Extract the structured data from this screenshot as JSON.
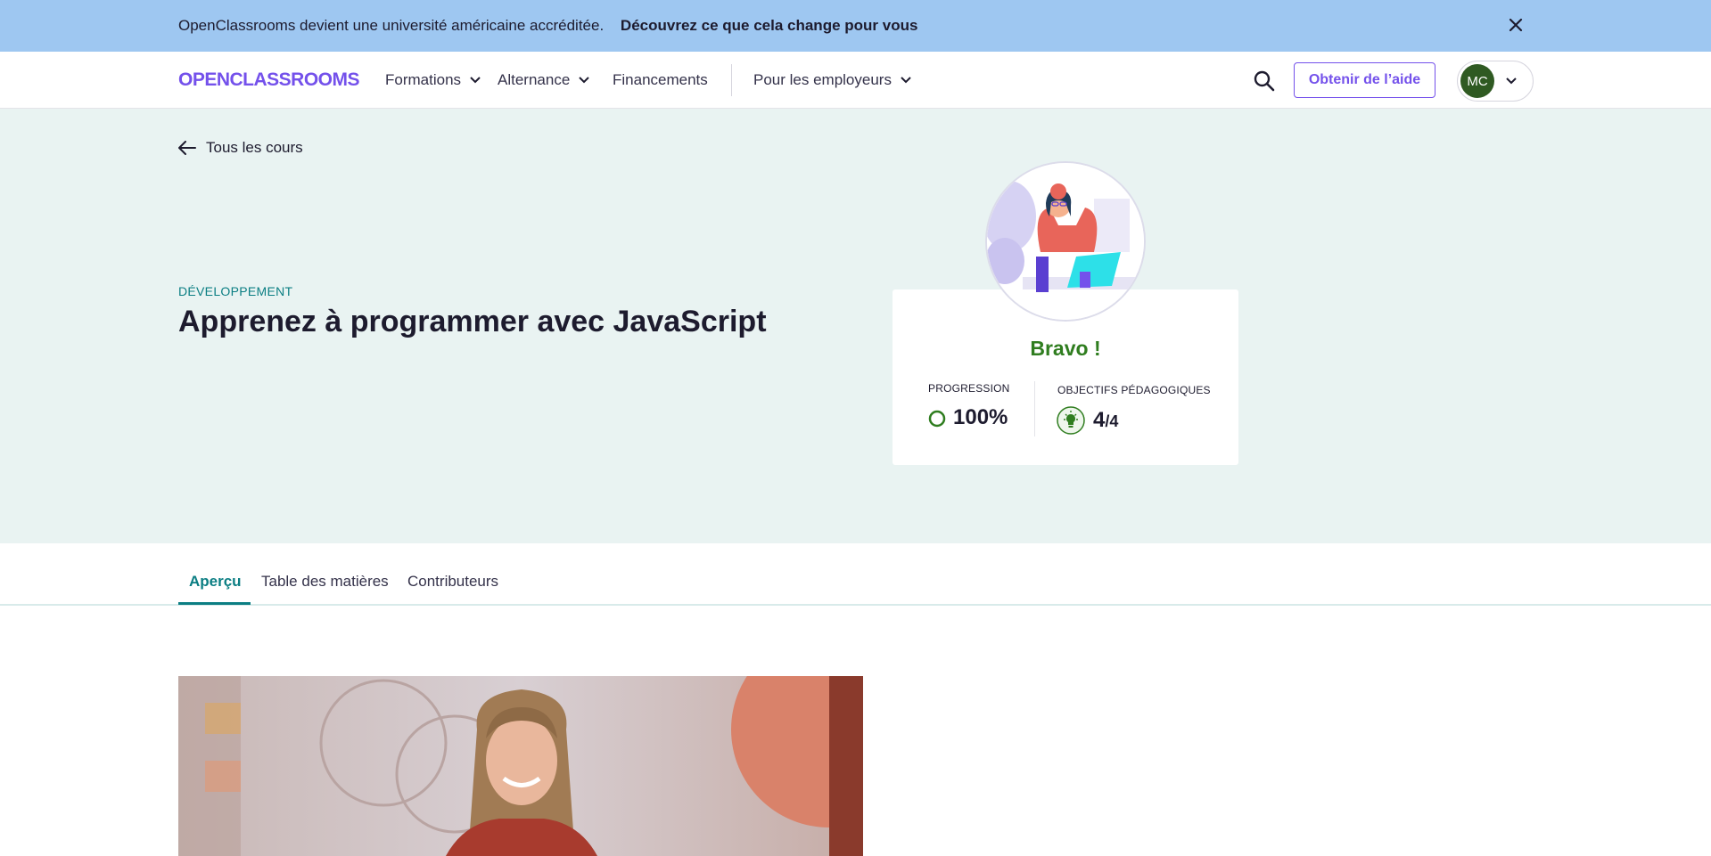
{
  "banner": {
    "text": "OpenClassrooms devient une université américaine accréditée.",
    "link": "Découvrez ce que cela change pour vous"
  },
  "nav": {
    "logo": "OPENCLASSROOMS",
    "items": [
      {
        "label": "Formations"
      },
      {
        "label": "Alternance"
      },
      {
        "label": "Financements"
      },
      {
        "label": "Pour les employeurs"
      }
    ],
    "help_label": "Obtenir de l’aide",
    "avatar_initials": "MC"
  },
  "hero": {
    "back_label": "Tous les cours",
    "category": "DÉVELOPPEMENT",
    "title": "Apprenez à programmer avec JavaScript"
  },
  "card": {
    "bravo": "Bravo !",
    "progress_label": "PROGRESSION",
    "progress_value": "100%",
    "objectives_label": "OBJECTIFS PÉDAGOGIQUES",
    "objectives_done": "4",
    "objectives_total": "/4"
  },
  "tabs": [
    {
      "label": "Aperçu"
    },
    {
      "label": "Table des matières"
    },
    {
      "label": "Contributeurs"
    }
  ],
  "colors": {
    "brand": "#7451eb",
    "banner": "#9ec7f1",
    "hero_bg": "#e9f3f2",
    "accent_teal": "#0b7e83",
    "success": "#2f7d1f"
  }
}
